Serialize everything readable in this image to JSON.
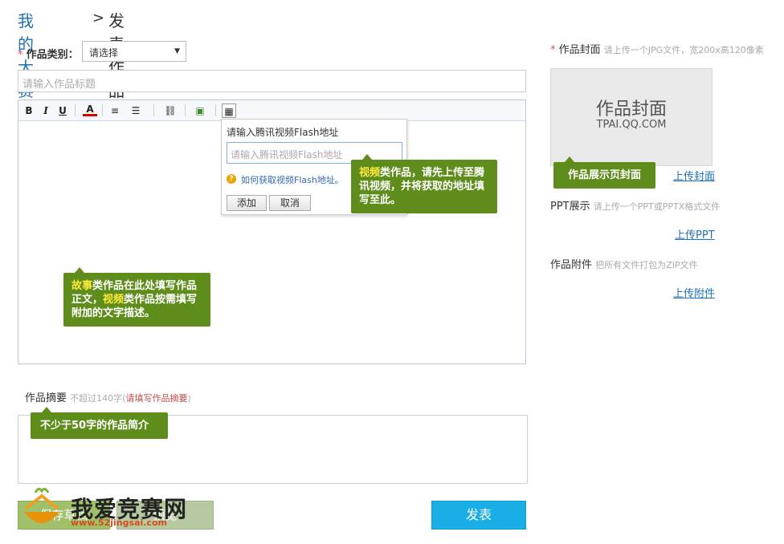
{
  "breadcrumb": {
    "parent": "我的大赛",
    "separator": ">",
    "current": "发表作品"
  },
  "category": {
    "required_mark": "*",
    "label": "作品类别：",
    "selected": "请选择"
  },
  "title_input": {
    "placeholder": "请输入作品标题"
  },
  "editor": {
    "toolbar": {
      "bold": "B",
      "italic": "I",
      "underline": "U",
      "font_color": "A",
      "align": "≡",
      "list": "☰",
      "link": "⛓",
      "image": "▣",
      "video": "▦"
    }
  },
  "video_dialog": {
    "title": "请输入腾讯视频Flash地址",
    "input_placeholder": "请输入腾讯视频Flash地址",
    "help_icon": "?",
    "help_text": "如何获取视频Flash地址。",
    "add_button": "添加",
    "cancel_button": "取消"
  },
  "tips": {
    "video_hl": "视频",
    "video_rest": "类作品，请先上传至腾讯视频，并将获取的地址填写至此。",
    "story_hl1": "故事",
    "story_mid": "类作品在此处填写作品正文，",
    "story_hl2": "视频",
    "story_rest": "类作品按需填写附加的文字描述。",
    "summary": "不少于50字的作品简介",
    "cover": "作品展示页封面"
  },
  "summary": {
    "label": "作品摘要",
    "hint_prefix": "不超过140字(",
    "hint_red": "请填写作品摘要",
    "hint_suffix": ")"
  },
  "actions": {
    "save": "保存草稿",
    "preview": "预览",
    "publish": "发表"
  },
  "watermark": {
    "text": "我爱竞赛网",
    "url": "www.52jingsai.com"
  },
  "cover": {
    "required_mark": "*",
    "label": "作品封面",
    "hint": "请上传一个JPG文件，宽200x高120像素",
    "placeholder_title": "作品封面",
    "placeholder_sub": "TPAI.QQ.COM",
    "upload_link": "上传封面"
  },
  "ppt": {
    "label": "PPT展示",
    "hint": "请上传一个PPT或PPTX格式文件",
    "upload_link": "上传PPT"
  },
  "attachment": {
    "label": "作品附件",
    "hint": "把所有文件打包为ZIP文件",
    "upload_link": "上传附件"
  },
  "colors": {
    "accent_blue": "#1f6fb4",
    "tip_green": "#5f8d1c",
    "tip_highlight": "#ffe93a",
    "publish_blue": "#1aaee6",
    "save_green": "#a0c06c"
  }
}
